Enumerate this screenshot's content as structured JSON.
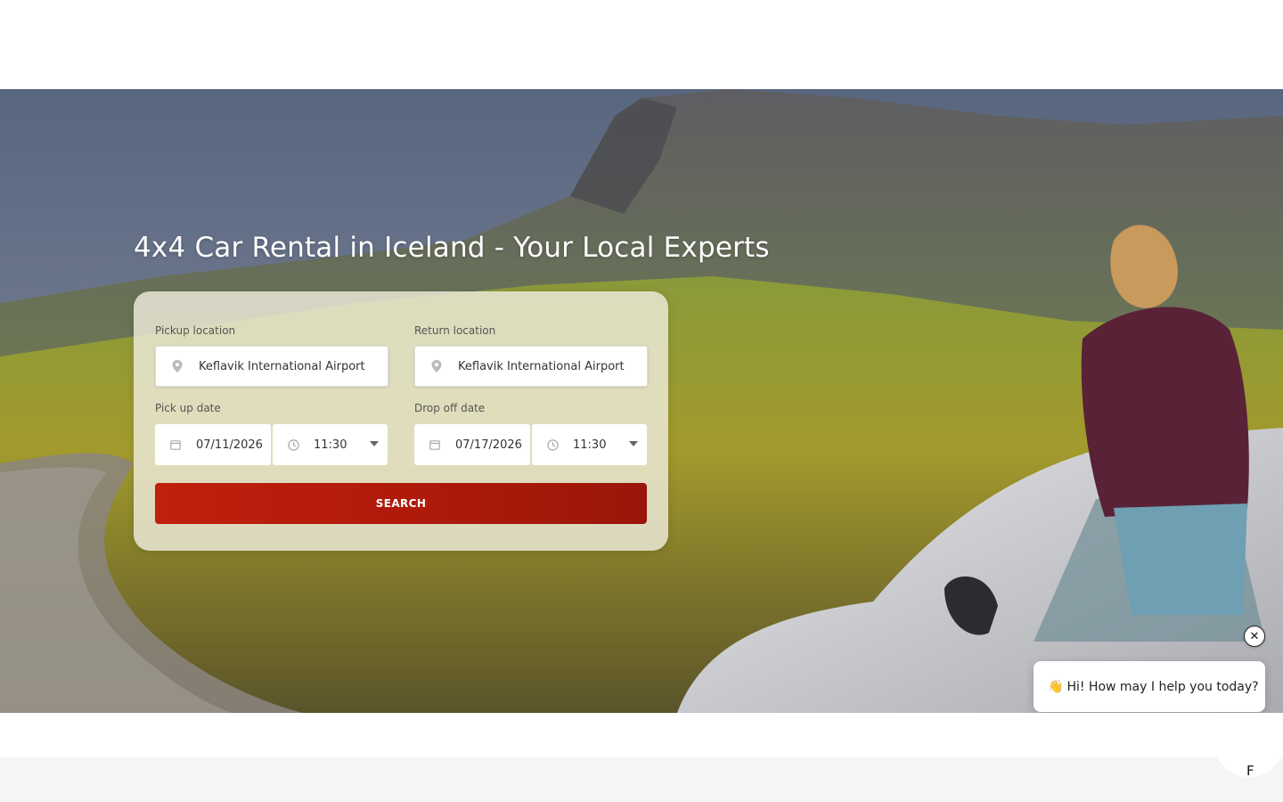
{
  "hero": {
    "title": "4x4 Car Rental in Iceland - Your Local Experts"
  },
  "search_form": {
    "pickup_location": {
      "label": "Pickup location",
      "value": "Keflavik International Airport",
      "icon": "location-pin-icon"
    },
    "return_location": {
      "label": "Return location",
      "value": "Keflavik International Airport",
      "icon": "location-pin-icon"
    },
    "pickup_date": {
      "label": "Pick up date",
      "date": "07/11/2026",
      "time": "11:30"
    },
    "dropoff_date": {
      "label": "Drop off date",
      "date": "07/17/2026",
      "time": "11:30"
    },
    "search_label": "SEARCH",
    "search_color": "#b51c0b"
  },
  "chat": {
    "close_label": "✕",
    "message": "Hi! How may I help you today?",
    "wave_glyph": "👋",
    "launcher_label": "F"
  }
}
